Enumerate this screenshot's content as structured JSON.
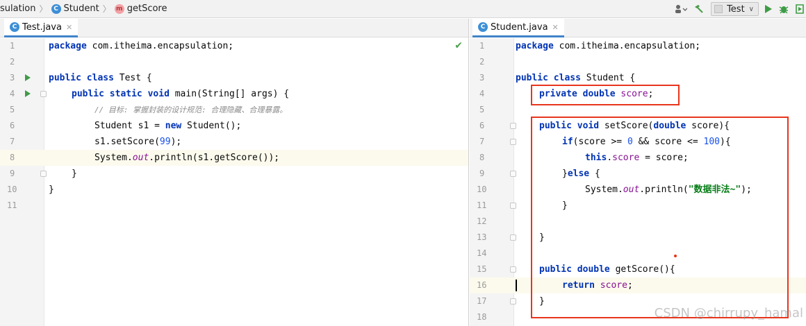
{
  "breadcrumb": {
    "items": [
      {
        "label": "sulation",
        "icon": "none"
      },
      {
        "label": "Student",
        "icon": "class-icon"
      },
      {
        "label": "getScore",
        "icon": "method-icon"
      }
    ],
    "class_icon_letter": "C",
    "method_icon_letter": "m"
  },
  "toolbar": {
    "run_config": "Test",
    "icons": [
      "user-icon",
      "build-hammer-icon",
      "run-icon",
      "debug-icon",
      "coverage-icon"
    ]
  },
  "left_pane": {
    "tab_label": "Test.java",
    "lines": [
      "1",
      "2",
      "3",
      "4",
      "5",
      "6",
      "7",
      "8",
      "9",
      "10",
      "11"
    ]
  },
  "right_pane": {
    "tab_label": "Student.java",
    "lines": [
      "1",
      "2",
      "3",
      "4",
      "5",
      "6",
      "7",
      "8",
      "9",
      "10",
      "11",
      "12",
      "13",
      "14",
      "15",
      "16",
      "17",
      "18"
    ]
  },
  "code_text": {
    "pkg": "package",
    "pkg_name": " com.itheima.encapsulation;",
    "public": "public",
    "class": "class",
    "static": "static",
    "void": "void",
    "new": "new",
    "private": "private",
    "double": "double",
    "if": "if",
    "else": "else",
    "this": "this",
    "return": "return",
    "test_name": " Test {",
    "student_name": " Student {",
    "main_sig": " main(String[] args) {",
    "comment": "// 目标: 掌握封装的设计规范: 合理隐藏、合理暴露。",
    "s1_decl": "Student s1 = ",
    "student_ctor": " Student();",
    "setscore_call": "s1.setScore(",
    "setscore_arg": "99",
    "setscore_end": ");",
    "sysout_prefix": "System.",
    "out": "out",
    "println_getscore": ".println(s1.getScore());",
    "close_brace": "}",
    "score_field": "score",
    "semicolon": ";",
    "setscore_sig": " setScore(",
    "score_param": " score){",
    "if_cond_a": "(score >= ",
    "zero": "0",
    "if_cond_b": " && score <= ",
    "hundred": "100",
    "if_cond_c": "){",
    "dot": ".",
    "assign": " = score;",
    "else_open": " {",
    "println_open": ".println(",
    "error_msg": "\"数据非法~\"",
    "println_close": ");",
    "getscore_sig": " getScore(){",
    "else_brace": "}"
  },
  "watermark": "CSDN @chirrupy_hamal"
}
